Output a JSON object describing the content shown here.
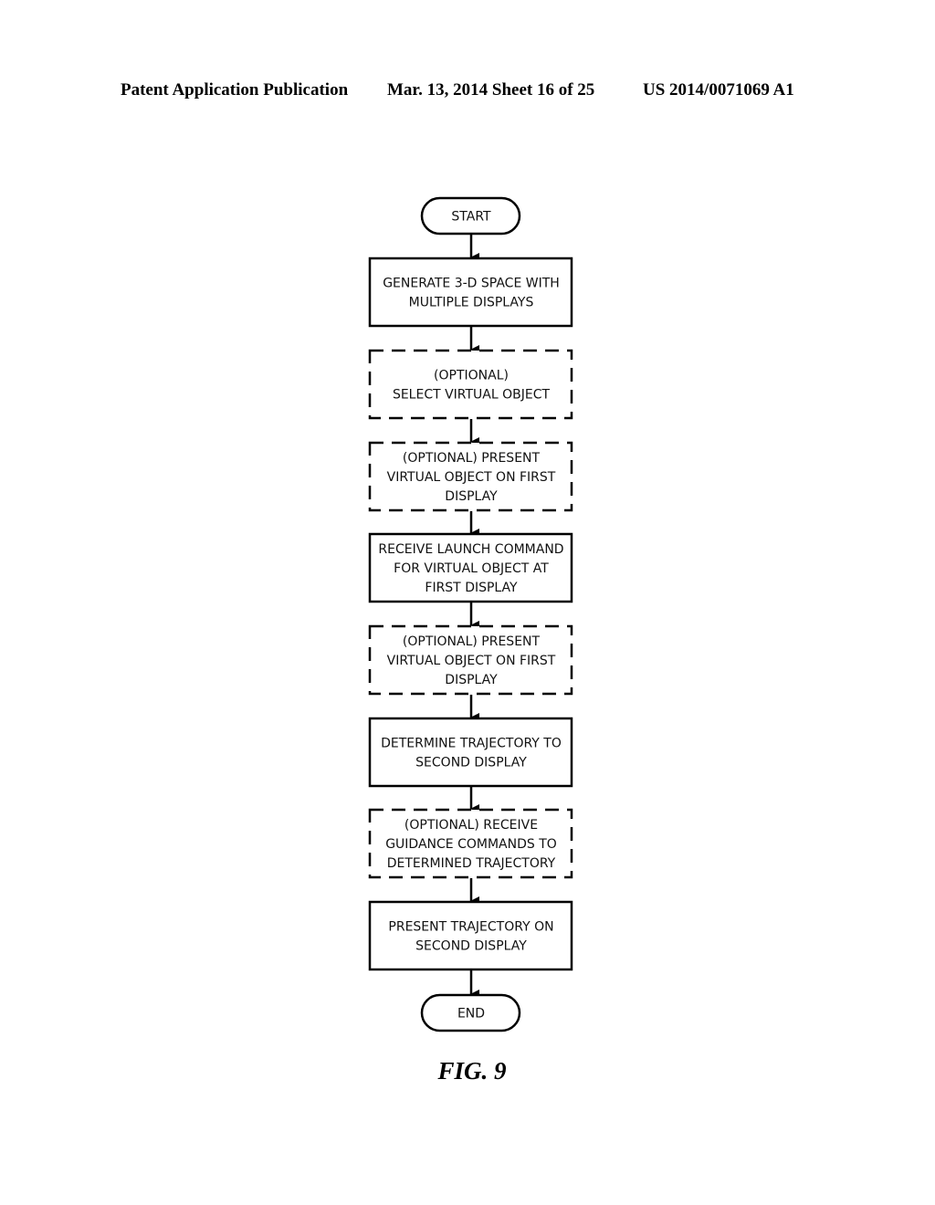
{
  "header": {
    "left": "Patent Application Publication",
    "middle": "Mar. 13, 2014  Sheet 16 of 25",
    "right": "US 2014/0071069 A1"
  },
  "flowchart": {
    "nodes": [
      {
        "id": "start",
        "shape": "terminal",
        "lines": [
          "START"
        ]
      },
      {
        "id": "step1",
        "shape": "process",
        "style": "solid",
        "lines": [
          "GENERATE 3-D SPACE WITH",
          "MULTIPLE DISPLAYS"
        ]
      },
      {
        "id": "step2",
        "shape": "process",
        "style": "dashed",
        "lines": [
          "(OPTIONAL)",
          "SELECT VIRTUAL OBJECT"
        ]
      },
      {
        "id": "step3",
        "shape": "process",
        "style": "dashed",
        "lines": [
          "(OPTIONAL) PRESENT",
          "VIRTUAL OBJECT ON FIRST",
          "DISPLAY"
        ]
      },
      {
        "id": "step4",
        "shape": "process",
        "style": "solid",
        "lines": [
          "RECEIVE LAUNCH COMMAND",
          "FOR VIRTUAL OBJECT AT",
          "FIRST DISPLAY"
        ]
      },
      {
        "id": "step5",
        "shape": "process",
        "style": "dashed",
        "lines": [
          "(OPTIONAL) PRESENT",
          "VIRTUAL OBJECT ON FIRST",
          "DISPLAY"
        ]
      },
      {
        "id": "step6",
        "shape": "process",
        "style": "solid",
        "lines": [
          "DETERMINE TRAJECTORY TO",
          "SECOND DISPLAY"
        ]
      },
      {
        "id": "step7",
        "shape": "process",
        "style": "dashed",
        "lines": [
          "(OPTIONAL) RECEIVE",
          "GUIDANCE COMMANDS TO",
          "DETERMINED TRAJECTORY"
        ]
      },
      {
        "id": "step8",
        "shape": "process",
        "style": "solid",
        "lines": [
          "PRESENT TRAJECTORY ON",
          "SECOND DISPLAY"
        ]
      },
      {
        "id": "end",
        "shape": "terminal",
        "lines": [
          "END"
        ]
      }
    ],
    "edges": [
      [
        "start",
        "step1"
      ],
      [
        "step1",
        "step2"
      ],
      [
        "step2",
        "step3"
      ],
      [
        "step3",
        "step4"
      ],
      [
        "step4",
        "step5"
      ],
      [
        "step5",
        "step6"
      ],
      [
        "step6",
        "step7"
      ],
      [
        "step7",
        "step8"
      ],
      [
        "step8",
        "end"
      ]
    ]
  },
  "figure_label": "FIG. 9"
}
